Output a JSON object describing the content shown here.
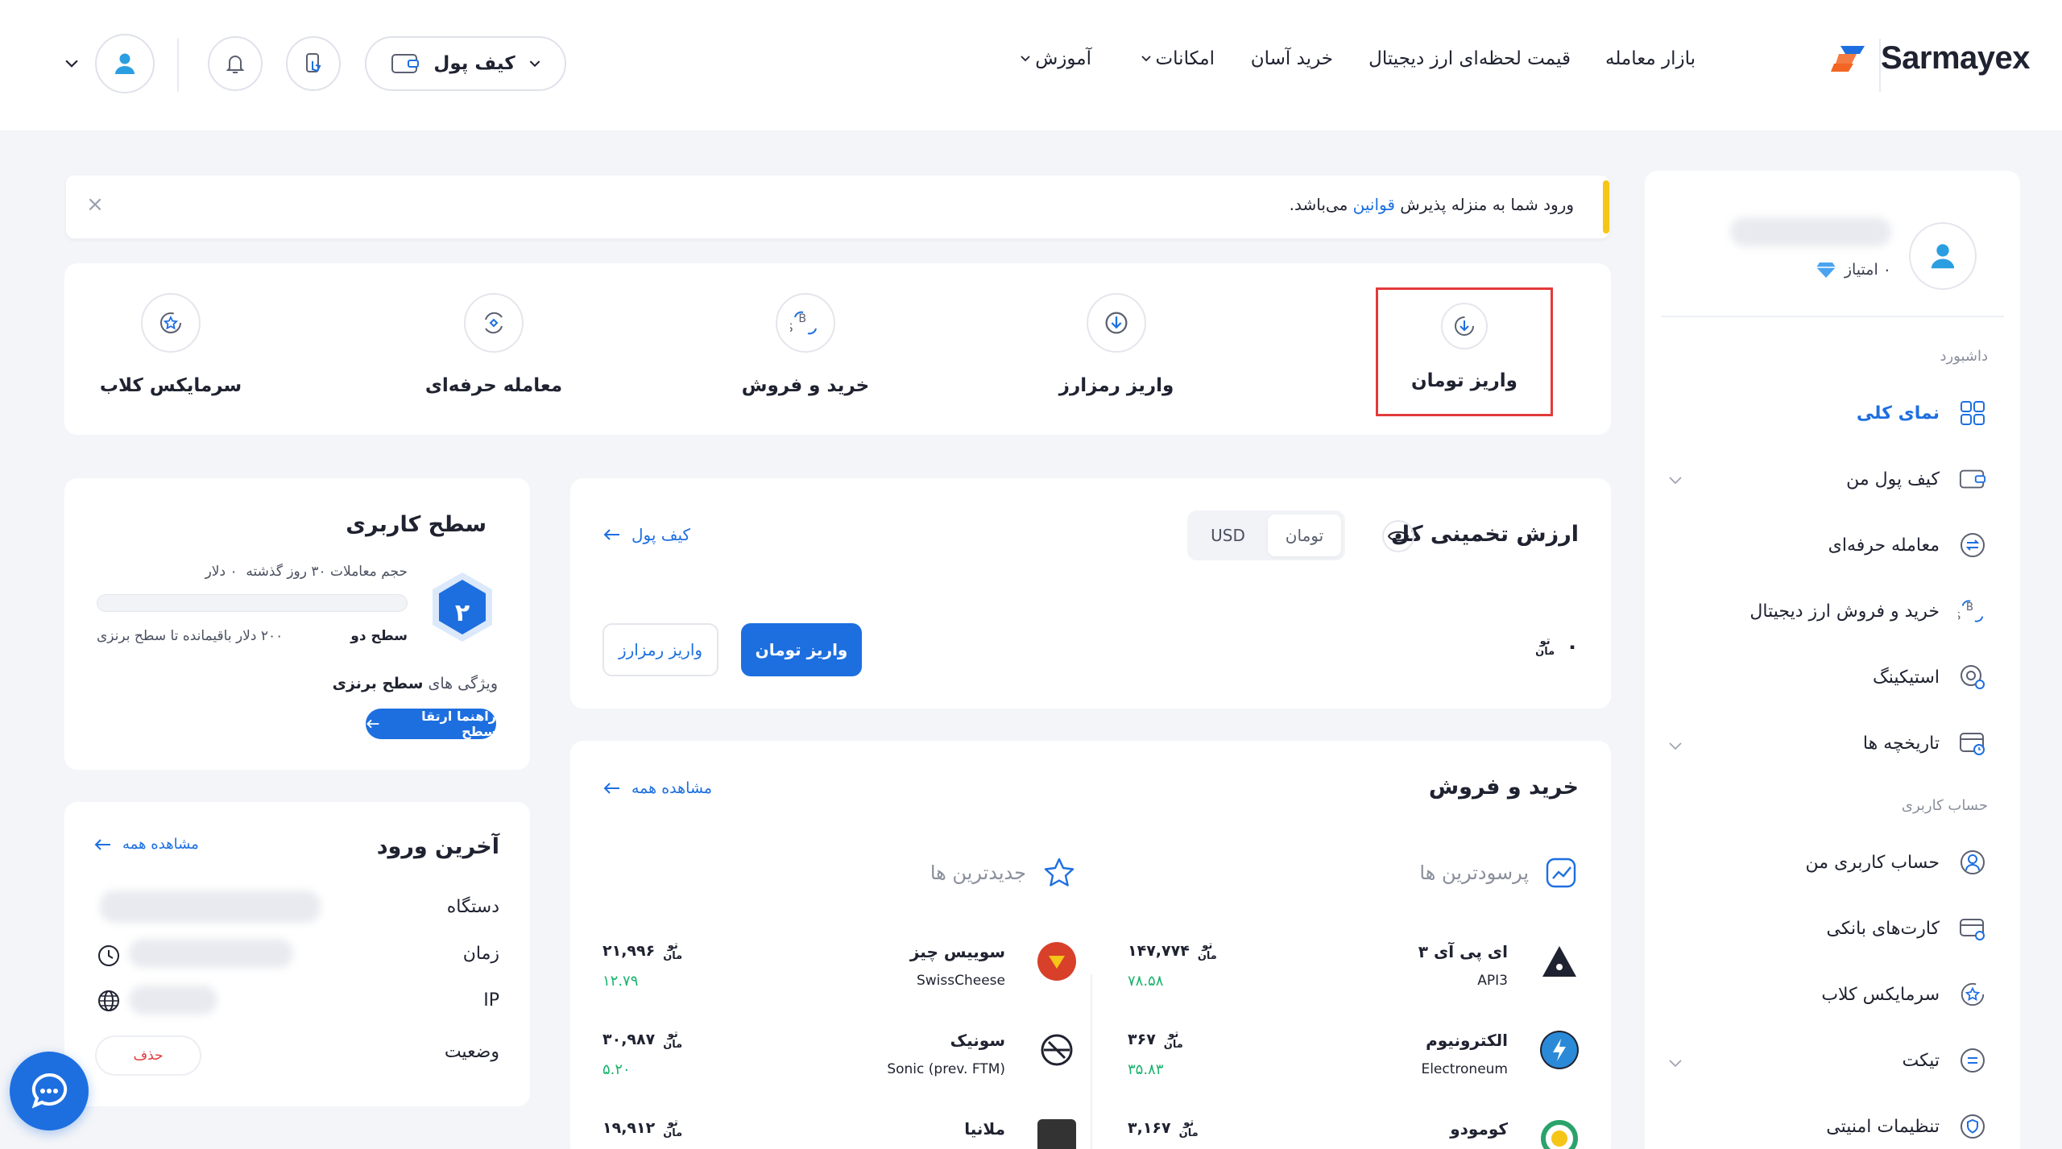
{
  "header": {
    "brand": "Sarmayex",
    "nav": [
      {
        "label": "بازار معامله",
        "dropdown": false
      },
      {
        "label": "قیمت لحظه‌ای ارز دیجیتال",
        "dropdown": false
      },
      {
        "label": "خرید آسان",
        "dropdown": false
      },
      {
        "label": "امکانات",
        "dropdown": true
      },
      {
        "label": "آموزش",
        "dropdown": true
      }
    ],
    "wallet_label": "کیف پول"
  },
  "notice": {
    "text_before": "ورود شما به منزله پذیرش ",
    "link": "قوانین",
    "text_after": " می‌باشد."
  },
  "quick_actions": [
    {
      "label": "واریز تومان",
      "icon": "deposit-icon",
      "highlighted": true
    },
    {
      "label": "واریز رمزارز",
      "icon": "crypto-deposit-icon",
      "highlighted": false
    },
    {
      "label": "خرید و فروش",
      "icon": "exchange-icon",
      "highlighted": false
    },
    {
      "label": "معامله حرفه‌ای",
      "icon": "trade-icon",
      "highlighted": false
    },
    {
      "label": "سرمایکس کلاب",
      "icon": "club-star-icon",
      "highlighted": false
    }
  ],
  "sidebar": {
    "score": "۰ امتیاز",
    "category_dashboard": "داشبورد",
    "category_account": "حساب کاربری",
    "items": [
      {
        "label": "نمای کلی",
        "active": true
      },
      {
        "label": "کیف پول من",
        "active": false
      },
      {
        "label": "معامله حرفه‌ای",
        "active": false
      },
      {
        "label": "خرید و فروش ارز دیجیتال",
        "active": false
      },
      {
        "label": "استیکینگ",
        "active": false
      },
      {
        "label": "تاریخچه ها",
        "active": false
      },
      {
        "label": "حساب کاربری من",
        "active": false
      },
      {
        "label": "کارت‌های بانکی",
        "active": false
      },
      {
        "label": "سرمایکس کلاب",
        "active": false
      },
      {
        "label": "تیکت",
        "active": false
      },
      {
        "label": "تنظیمات امنیتی",
        "active": false
      }
    ]
  },
  "total_value": {
    "title": "ارزش تخمینی کل",
    "currency_options": [
      "تومان",
      "USD"
    ],
    "selected_currency": "تومان",
    "amount": "۰",
    "toman_top": "تو",
    "toman_bottom": "مان",
    "wallet_link": "کیف پول",
    "deposit_toman_button": "واریز تومان",
    "deposit_crypto_button": "واریز رمزارز"
  },
  "user_level": {
    "title": "سطح کاربری",
    "level_number": "۲",
    "volume_label": "حجم معاملات ۳۰ روز گذشته",
    "volume_value": "۰ دلار",
    "progress_fraction": 0,
    "current_level": "سطح دو",
    "remaining": "۲۰۰ دلار باقیمانده تا سطح برنزی",
    "features_prefix": "ویژگی های ",
    "features_level": "سطح برنزی",
    "guide_button": "راهنما ارتقا سطح"
  },
  "last_login": {
    "title": "آخرین ورود",
    "see_all": "مشاهده همه",
    "rows": {
      "device": "دستگاه",
      "time": "زمان",
      "ip": "IP",
      "status": "وضعیت"
    },
    "delete_button": "حذف"
  },
  "buy_sell": {
    "title": "خرید و فروش",
    "see_all": "مشاهده همه",
    "tab_profitable": "پرسودترین ها",
    "tab_newest": "جدیدترین ها",
    "toman_top": "تو",
    "toman_bottom": "مان",
    "profitable": [
      {
        "name": "ای پی آی ۳",
        "symbol": "API3",
        "price": "۱۴۷,۷۷۴",
        "change": "۷۸.۵۸",
        "color": "#1f2230"
      },
      {
        "name": "الکترونیوم",
        "symbol": "Electroneum",
        "price": "۳۶۷",
        "change": "۳۵.۸۳",
        "color": "#2a8ad8"
      },
      {
        "name": "کومودو",
        "symbol": "",
        "price": "۳,۱۶۷",
        "change": "",
        "color": "#2aa36b"
      }
    ],
    "newest": [
      {
        "name": "سوییس چیز",
        "symbol": "SwissCheese",
        "price": "۲۱,۹۹۶",
        "change": "۱۲.۷۹",
        "color": "#d8402a"
      },
      {
        "name": "سونیک",
        "symbol": "Sonic (prev. FTM)",
        "price": "۳۰,۹۸۷",
        "change": "۵.۲۰",
        "color": "#1f2230"
      },
      {
        "name": "ملانیا",
        "symbol": "",
        "price": "۱۹,۹۱۲",
        "change": "",
        "color": "#333333"
      }
    ]
  },
  "colors": {
    "accent": "#1d6fe0",
    "positive": "#18b36b",
    "highlight": "#e23a3a",
    "notice_bar": "#f5c518"
  }
}
